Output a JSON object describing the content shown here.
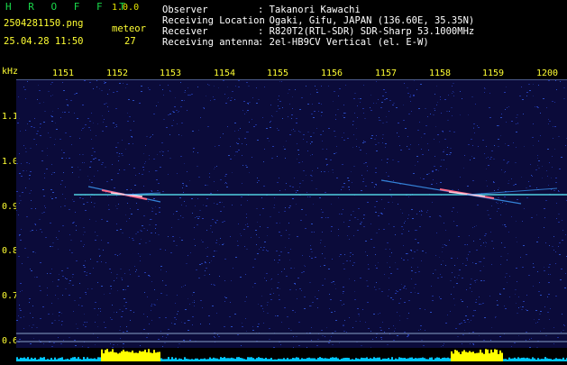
{
  "header": {
    "app_title": "H R O F F T",
    "version": "1.0.0",
    "filename": "2504281150.png",
    "datetime": "25.04.28 11:50",
    "meteor_label": "meteor",
    "meteor_count": "27",
    "fields": [
      {
        "label": "Observer",
        "value": ": Takanori Kawachi"
      },
      {
        "label": "Receiving Location",
        "value": ": Ogaki, Gifu, JAPAN (136.60E, 35.35N)"
      },
      {
        "label": "Receiver",
        "value": ": R820T2(RTL-SDR) SDR-Sharp 53.1000MHz"
      },
      {
        "label": "Receiving antenna",
        "value": ": 2el-HB9CV Vertical (el. E-W)"
      }
    ]
  },
  "axes": {
    "unit": "kHz",
    "time_ticks": [
      "1151",
      "1152",
      "1153",
      "1154",
      "1155",
      "1156",
      "1157",
      "1158",
      "1159",
      "1200"
    ],
    "freq_ticks": [
      "1.1",
      "1.0",
      "0.9",
      "0.8",
      "0.7",
      "0.6"
    ]
  },
  "colors": {
    "label": "#ffff33",
    "title": "#19d84a",
    "background": "#0b0b3a",
    "carrier": "#4fd0e0",
    "echo": "#ff6a88",
    "spectrum_fill": "#ffff00",
    "spectrum_base": "#00c8ff"
  }
}
